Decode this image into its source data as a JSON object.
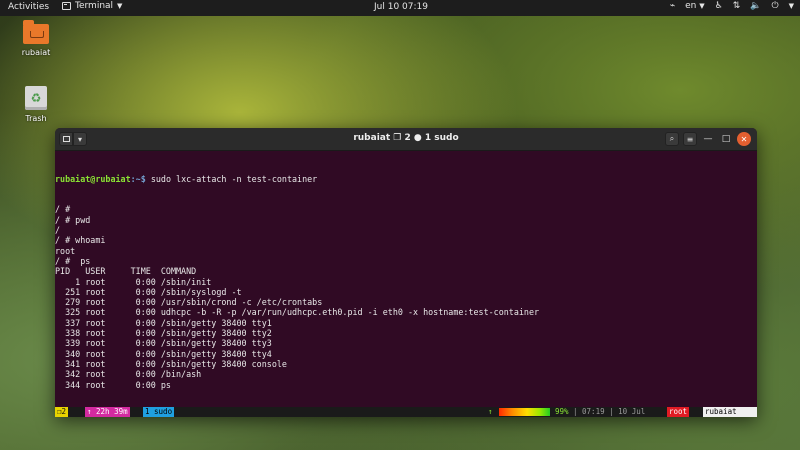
{
  "topbar": {
    "activities": "Activities",
    "app_name": "Terminal",
    "clock": "Jul 10  07:19",
    "language": "en"
  },
  "desktop": {
    "icons": [
      {
        "label": "rubaiat",
        "icon": "folder-icon"
      },
      {
        "label": "Trash",
        "icon": "trash-icon"
      }
    ]
  },
  "window": {
    "title": "rubaiat ❐ 2 ● 1 sudo"
  },
  "terminal": {
    "prompt_user": "rubaiat@rubaiat",
    "prompt_path": ":~$",
    "first_command": " sudo lxc-attach -n test-container",
    "lines": [
      "/ #",
      "/ # pwd",
      "/",
      "/ # whoami",
      "root",
      "/ #  ps",
      "PID   USER     TIME  COMMAND",
      "    1 root      0:00 /sbin/init",
      "  251 root      0:00 /sbin/syslogd -t",
      "  279 root      0:00 /usr/sbin/crond -c /etc/crontabs",
      "  325 root      0:00 udhcpc -b -R -p /var/run/udhcpc.eth0.pid -i eth0 -x hostname:test-container",
      "  337 root      0:00 /sbin/getty 38400 tty1",
      "  338 root      0:00 /sbin/getty 38400 tty2",
      "  339 root      0:00 /sbin/getty 38400 tty3",
      "  340 root      0:00 /sbin/getty 38400 tty4",
      "  341 root      0:00 /sbin/getty 38400 console",
      "  342 root      0:00 /bin/ash",
      "  344 root      0:00 ps"
    ],
    "last_prompt": "/ # "
  },
  "statusbar": {
    "window_index": "❐2",
    "uptime": "↑ 22h 39m",
    "tab": "1 sudo",
    "arrow": "↑",
    "battery_pct": "99%",
    "battery_level": 0.99,
    "time_date": "| 07:19 | 10 Jul",
    "user": "root",
    "host": "rubaiat"
  },
  "colors": {
    "terminal_bg": "#300a24",
    "prompt_user": "#8ae234",
    "prompt_path": "#729fcf"
  }
}
